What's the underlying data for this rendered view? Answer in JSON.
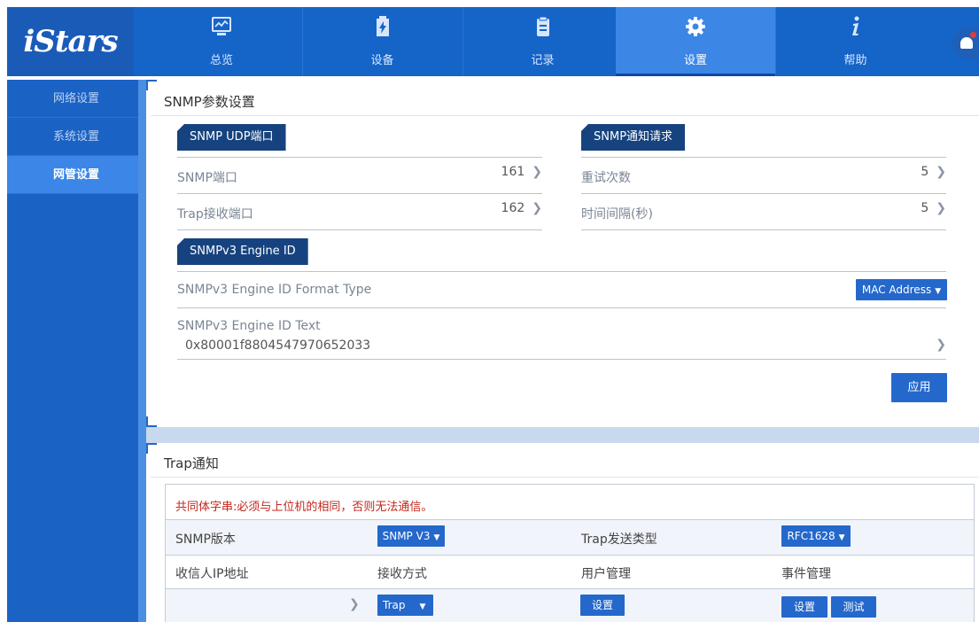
{
  "app": {
    "logo": "iStars"
  },
  "nav": {
    "tabs": [
      {
        "label": "总览",
        "icon": "monitor-chart-icon"
      },
      {
        "label": "设备",
        "icon": "battery-icon"
      },
      {
        "label": "记录",
        "icon": "clipboard-icon"
      },
      {
        "label": "设置",
        "icon": "gear-icon",
        "active": true
      },
      {
        "label": "帮助",
        "icon": "info-icon"
      }
    ]
  },
  "sidebar": {
    "items": [
      {
        "label": "网络设置"
      },
      {
        "label": "系统设置"
      },
      {
        "label": "网管设置",
        "active": true
      }
    ]
  },
  "snmp": {
    "title": "SNMP参数设置",
    "udp_section": "SNMP UDP端口",
    "notify_section": "SNMP通知请求",
    "port_label": "SNMP端口",
    "port_value": "161",
    "trap_port_label": "Trap接收端口",
    "trap_port_value": "162",
    "retry_label": "重试次数",
    "retry_value": "5",
    "interval_label": "时间间隔(秒)",
    "interval_value": "5",
    "engine_section": "SNMPv3 Engine ID",
    "format_label": "SNMPv3 Engine ID Format Type",
    "format_value": "MAC Address",
    "text_label": "SNMPv3 Engine ID Text",
    "text_value": "0x80001f8804547970652033",
    "apply_label": "应用"
  },
  "trap": {
    "title": "Trap通知",
    "warning": "共同体字串:必须与上位机的相同，否则无法通信。",
    "version_label": "SNMP版本",
    "version_value": "SNMP V3",
    "send_type_label": "Trap发送类型",
    "send_type_value": "RFC1628",
    "col_ip": "收信人IP地址",
    "col_mode": "接收方式",
    "col_user": "用户管理",
    "col_event": "事件管理",
    "row_mode_value": "Trap",
    "row_user_button": "设置",
    "row_event_set_button": "设置",
    "row_event_test_button": "测试"
  },
  "colors": {
    "header": "#1564c8",
    "active_tab": "#3c86e6",
    "sidebar": "#1a63c5",
    "tag": "#16437f",
    "button": "#2468cc",
    "warning": "#c4261d"
  }
}
